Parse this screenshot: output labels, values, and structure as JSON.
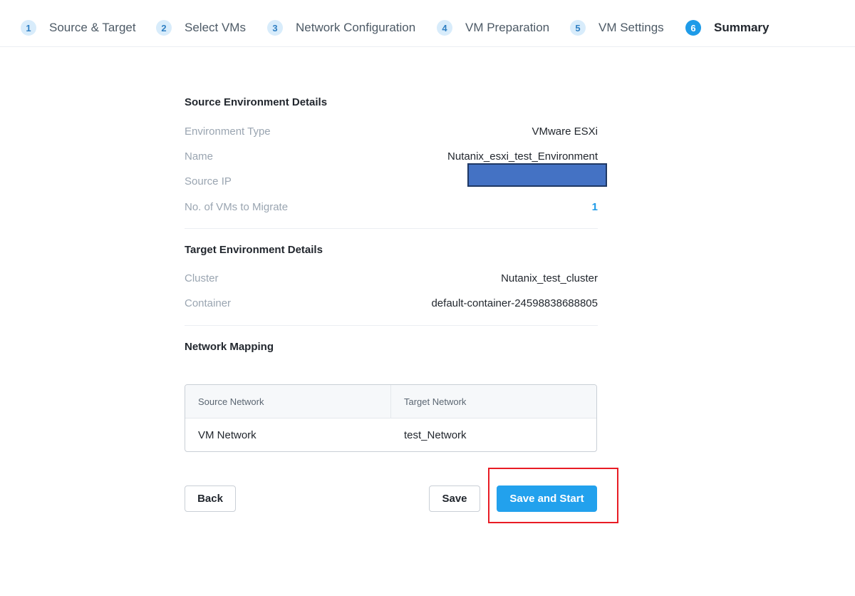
{
  "stepper": {
    "steps": [
      {
        "num": "1",
        "label": "Source & Target"
      },
      {
        "num": "2",
        "label": "Select VMs"
      },
      {
        "num": "3",
        "label": "Network Configuration"
      },
      {
        "num": "4",
        "label": "VM Preparation"
      },
      {
        "num": "5",
        "label": "VM Settings"
      },
      {
        "num": "6",
        "label": "Summary"
      }
    ],
    "active_step": "6"
  },
  "source": {
    "title": "Source Environment Details",
    "environment_type_label": "Environment Type",
    "environment_type_value": "VMware ESXi",
    "name_label": "Name",
    "name_value": "Nutanix_esxi_test_Environment",
    "source_ip_label": "Source IP",
    "vms_label": "No. of VMs to Migrate",
    "vms_value": "1"
  },
  "target": {
    "title": "Target Environment Details",
    "cluster_label": "Cluster",
    "cluster_value": "Nutanix_test_cluster",
    "container_label": "Container",
    "container_value": "default-container-24598838688805"
  },
  "network_mapping": {
    "title": "Network Mapping",
    "columns": [
      "Source Network",
      "Target Network"
    ],
    "rows": [
      [
        "VM Network",
        "test_Network"
      ]
    ]
  },
  "actions": {
    "back_label": "Back",
    "save_label": "Save",
    "save_start_label": "Save and Start"
  },
  "colors": {
    "accent": "#22a1ed",
    "highlight": "#e81c24",
    "redaction": "#4472c4"
  }
}
